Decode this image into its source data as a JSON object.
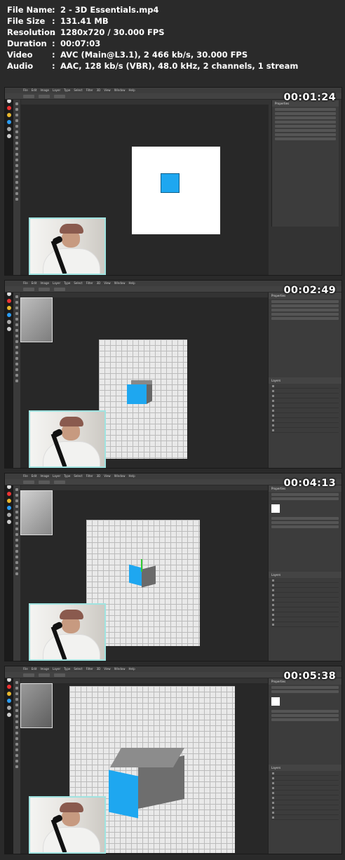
{
  "media_info": [
    {
      "key": "File Name",
      "value": "2 - 3D Essentials.mp4"
    },
    {
      "key": "File Size",
      "value": "131.41 MB"
    },
    {
      "key": "Resolution",
      "value": "1280x720 / 30.000 FPS"
    },
    {
      "key": "Duration",
      "value": "00:07:03"
    },
    {
      "key": "Video",
      "value": "AVC (Main@L3.1), 2 466 kb/s, 30.000 FPS"
    },
    {
      "key": "Audio",
      "value": "AAC, 128 kb/s (VBR), 48.0 kHz, 2 channels, 1 stream"
    }
  ],
  "separator": ":",
  "frames": [
    {
      "timestamp": "00:01:24",
      "scene": "2d-square"
    },
    {
      "timestamp": "00:02:49",
      "scene": "3d-cube-front"
    },
    {
      "timestamp": "00:04:13",
      "scene": "3d-cube-rotated"
    },
    {
      "timestamp": "00:05:38",
      "scene": "3d-cube-large"
    }
  ],
  "menu_items": [
    "File",
    "Edit",
    "Image",
    "Layer",
    "Type",
    "Select",
    "Filter",
    "3D",
    "View",
    "Window",
    "Help"
  ],
  "colors": {
    "cube": "#1ea7f0",
    "webcam_border": "#9fe3e0",
    "background": "#2a2a2a"
  }
}
